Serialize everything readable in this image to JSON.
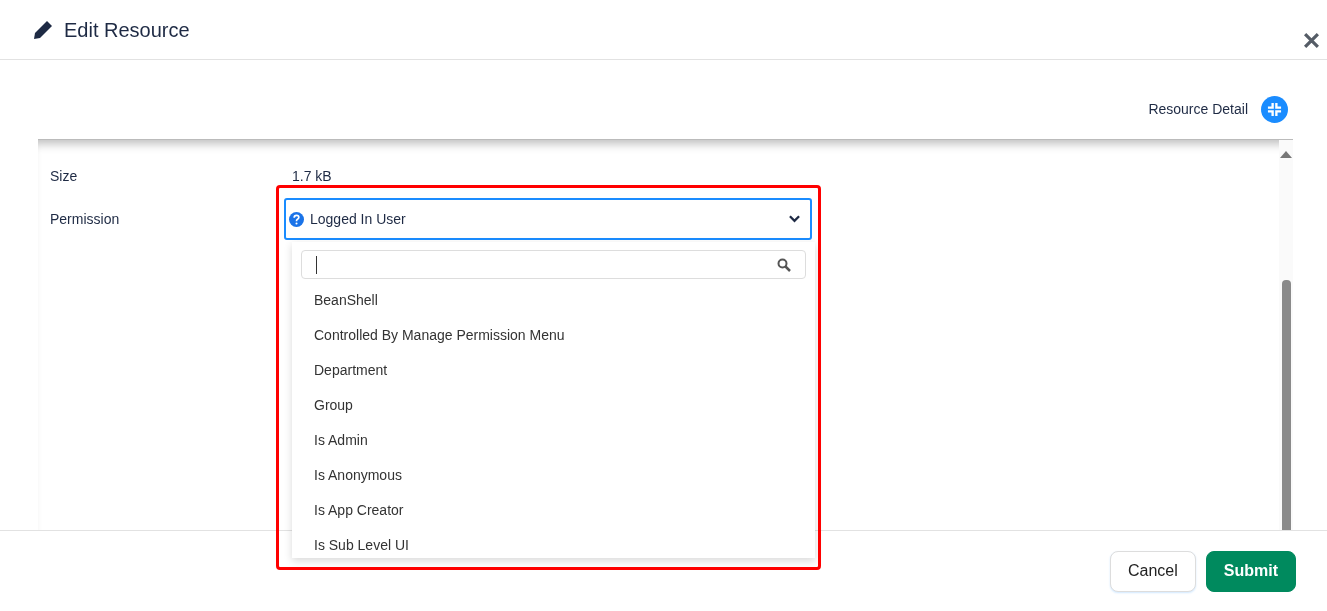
{
  "window": {
    "title": "Edit Resource"
  },
  "section": {
    "title": "Resource Detail"
  },
  "fields": [
    {
      "label": "Size",
      "value": "1.7 kB"
    },
    {
      "label": "Permission",
      "value": "Logged In User",
      "expanded": true
    }
  ],
  "dropdown": {
    "options": [
      {
        "label": "BeanShell"
      },
      {
        "label": "Controlled By Manage Permission Menu"
      },
      {
        "label": "Department"
      },
      {
        "label": "Group"
      },
      {
        "label": "Is Admin"
      },
      {
        "label": "Is Anonymous"
      },
      {
        "label": "Is App Creator"
      },
      {
        "label": "Is Sub Level UI"
      }
    ]
  },
  "buttons": [
    {
      "label": "Cancel",
      "kind": "secondary"
    },
    {
      "label": "Submit",
      "kind": "primary"
    }
  ]
}
